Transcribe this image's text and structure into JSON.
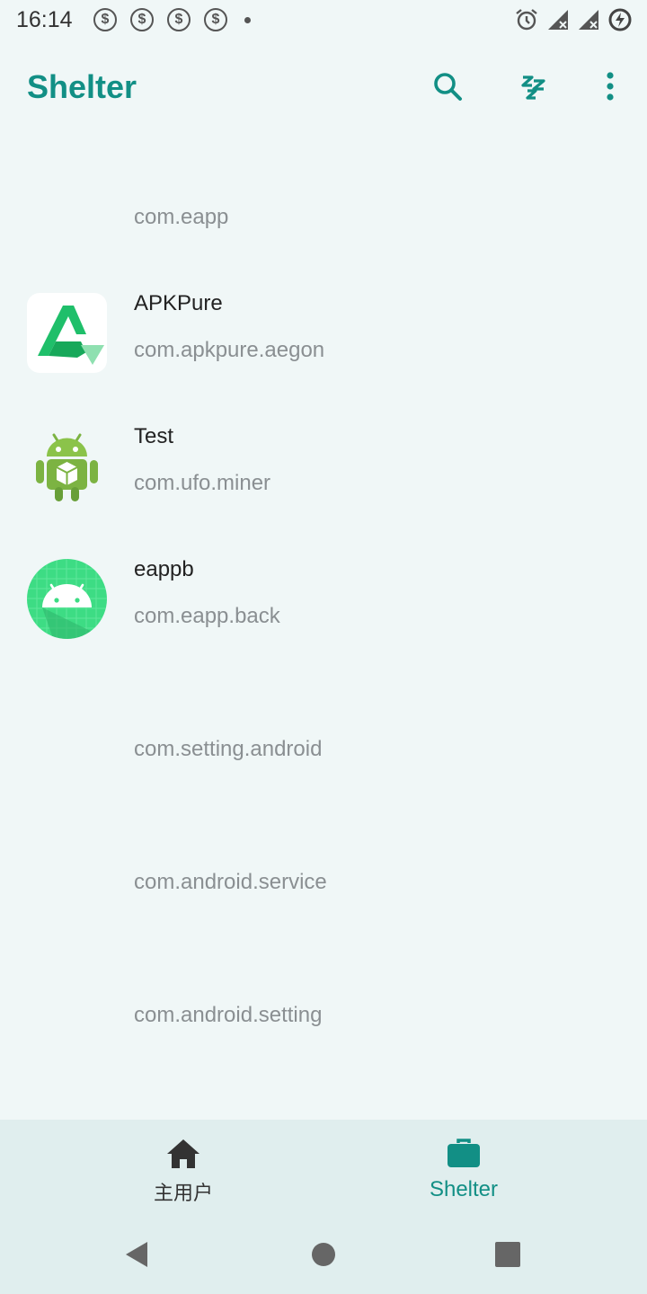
{
  "status_bar": {
    "time": "16:14",
    "notification_icons": [
      "dollar-icon",
      "dollar-icon",
      "dollar-icon",
      "dollar-icon"
    ],
    "dollar_glyph": "$",
    "right_icons": [
      "alarm-icon",
      "signal-icon",
      "signal-icon",
      "battery-saver-icon"
    ]
  },
  "app_bar": {
    "title": "Shelter",
    "accent_color": "#128f85",
    "actions": [
      "search-icon",
      "sleep-icon",
      "more-vert-icon"
    ]
  },
  "apps": [
    {
      "name": "",
      "package": "com.eapp",
      "icon": "none"
    },
    {
      "name": "APKPure",
      "package": "com.apkpure.aegon",
      "icon": "apkpure-icon"
    },
    {
      "name": "Test",
      "package": "com.ufo.miner",
      "icon": "android-robot-icon"
    },
    {
      "name": "eappb",
      "package": "com.eapp.back",
      "icon": "android-adaptive-icon"
    },
    {
      "name": "",
      "package": "com.setting.android",
      "icon": "none"
    },
    {
      "name": "",
      "package": "com.android.service",
      "icon": "none"
    },
    {
      "name": "",
      "package": "com.android.setting",
      "icon": "none"
    }
  ],
  "bottom_nav": {
    "home_label": "主用户",
    "shelter_label": "Shelter",
    "selected": "shelter"
  },
  "system_nav": [
    "back-icon",
    "home-circle-icon",
    "recents-icon"
  ]
}
